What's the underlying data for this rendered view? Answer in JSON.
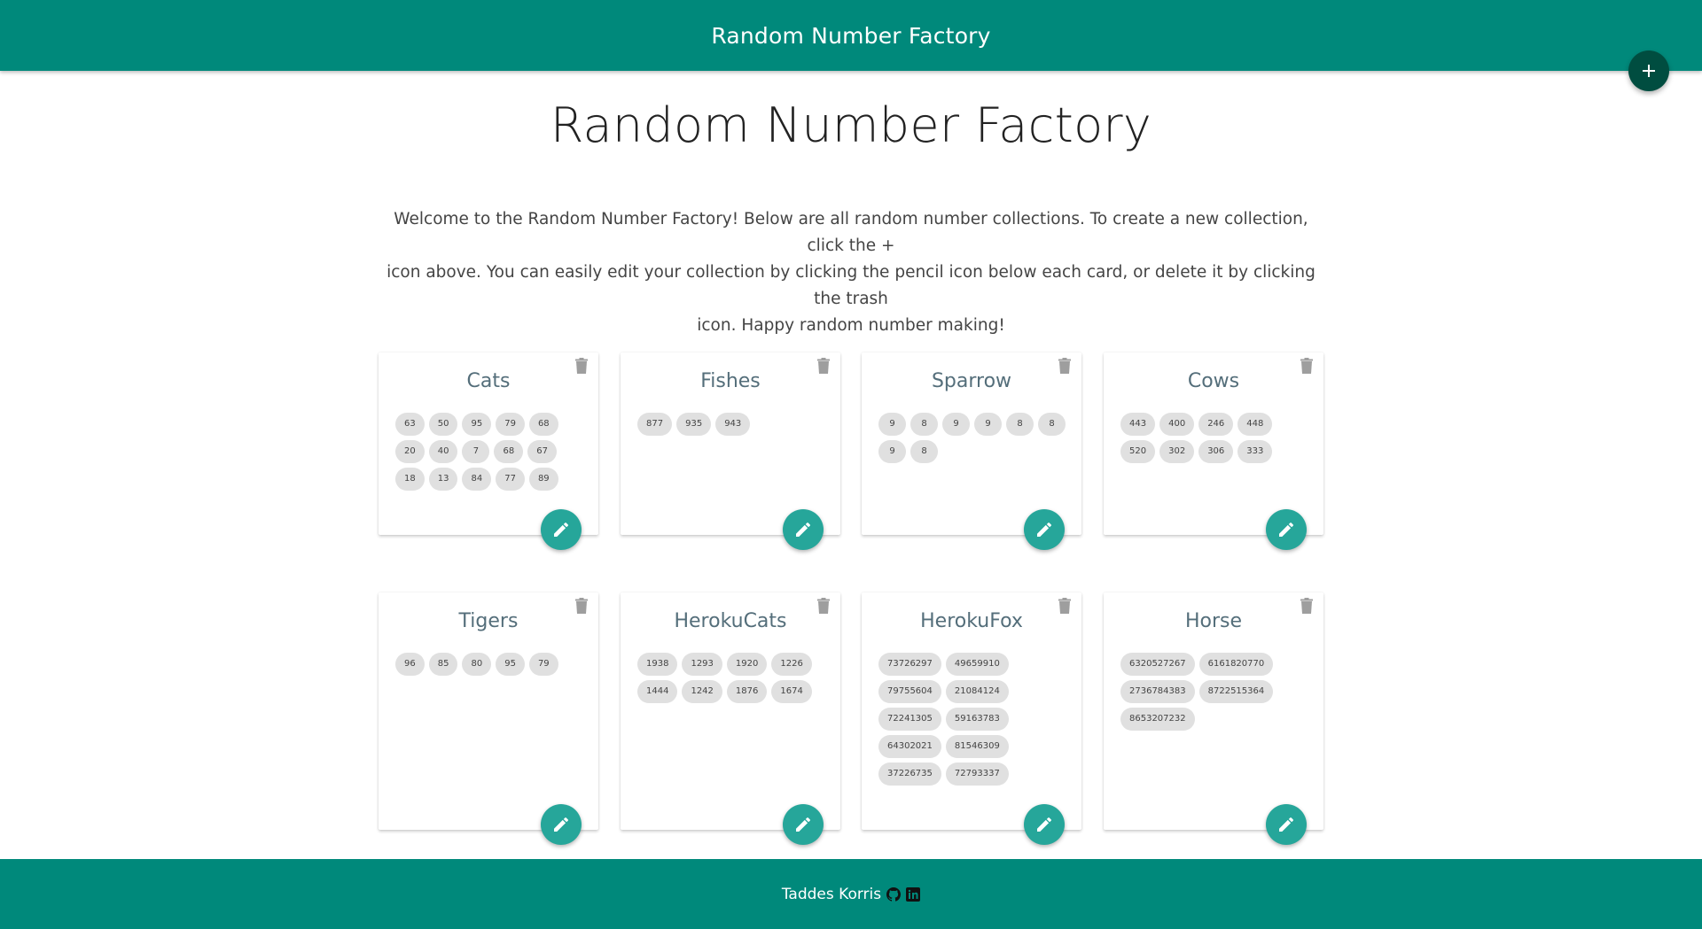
{
  "navbar": {
    "brand": "Random Number Factory"
  },
  "header": {
    "add_icon": "plus-icon"
  },
  "main": {
    "title": "Random Number Factory",
    "intro_line1": "Welcome to the Random Number Factory! Below are all random number collections. To create a new collection, click the +",
    "intro_line2": "icon above. You can easily edit your collection by clicking the pencil icon below each card, or delete it by clicking the trash",
    "intro_line3": "icon. Happy random number making!"
  },
  "collections": [
    {
      "name": "Cats",
      "numbers": [
        "63",
        "50",
        "95",
        "79",
        "68",
        "20",
        "40",
        "7",
        "68",
        "67",
        "18",
        "13",
        "84",
        "77",
        "89"
      ]
    },
    {
      "name": "Fishes",
      "numbers": [
        "877",
        "935",
        "943"
      ]
    },
    {
      "name": "Sparrow",
      "numbers": [
        "9",
        "8",
        "9",
        "9",
        "8",
        "8",
        "9",
        "8"
      ]
    },
    {
      "name": "Cows",
      "numbers": [
        "443",
        "400",
        "246",
        "448",
        "520",
        "302",
        "306",
        "333"
      ]
    },
    {
      "name": "Tigers",
      "numbers": [
        "96",
        "85",
        "80",
        "95",
        "79"
      ]
    },
    {
      "name": "HerokuCats",
      "numbers": [
        "1938",
        "1293",
        "1920",
        "1226",
        "1444",
        "1242",
        "1876",
        "1674"
      ]
    },
    {
      "name": "HerokuFox",
      "numbers": [
        "73726297",
        "49659910",
        "79755604",
        "21084124",
        "72241305",
        "59163783",
        "64302021",
        "81546309",
        "37226735",
        "72793337"
      ]
    },
    {
      "name": "Horse",
      "numbers": [
        "6320527267",
        "6161820770",
        "2736784383",
        "8722515364",
        "8653207232"
      ]
    }
  ],
  "footer": {
    "author": "Taddes Korris",
    "icons": [
      "github-icon",
      "linkedin-icon"
    ]
  },
  "colors": {
    "primary": "#00897b",
    "fab_dark": "#004d40",
    "fab_edit": "#26a69a",
    "chip": "#e0e0e0"
  }
}
